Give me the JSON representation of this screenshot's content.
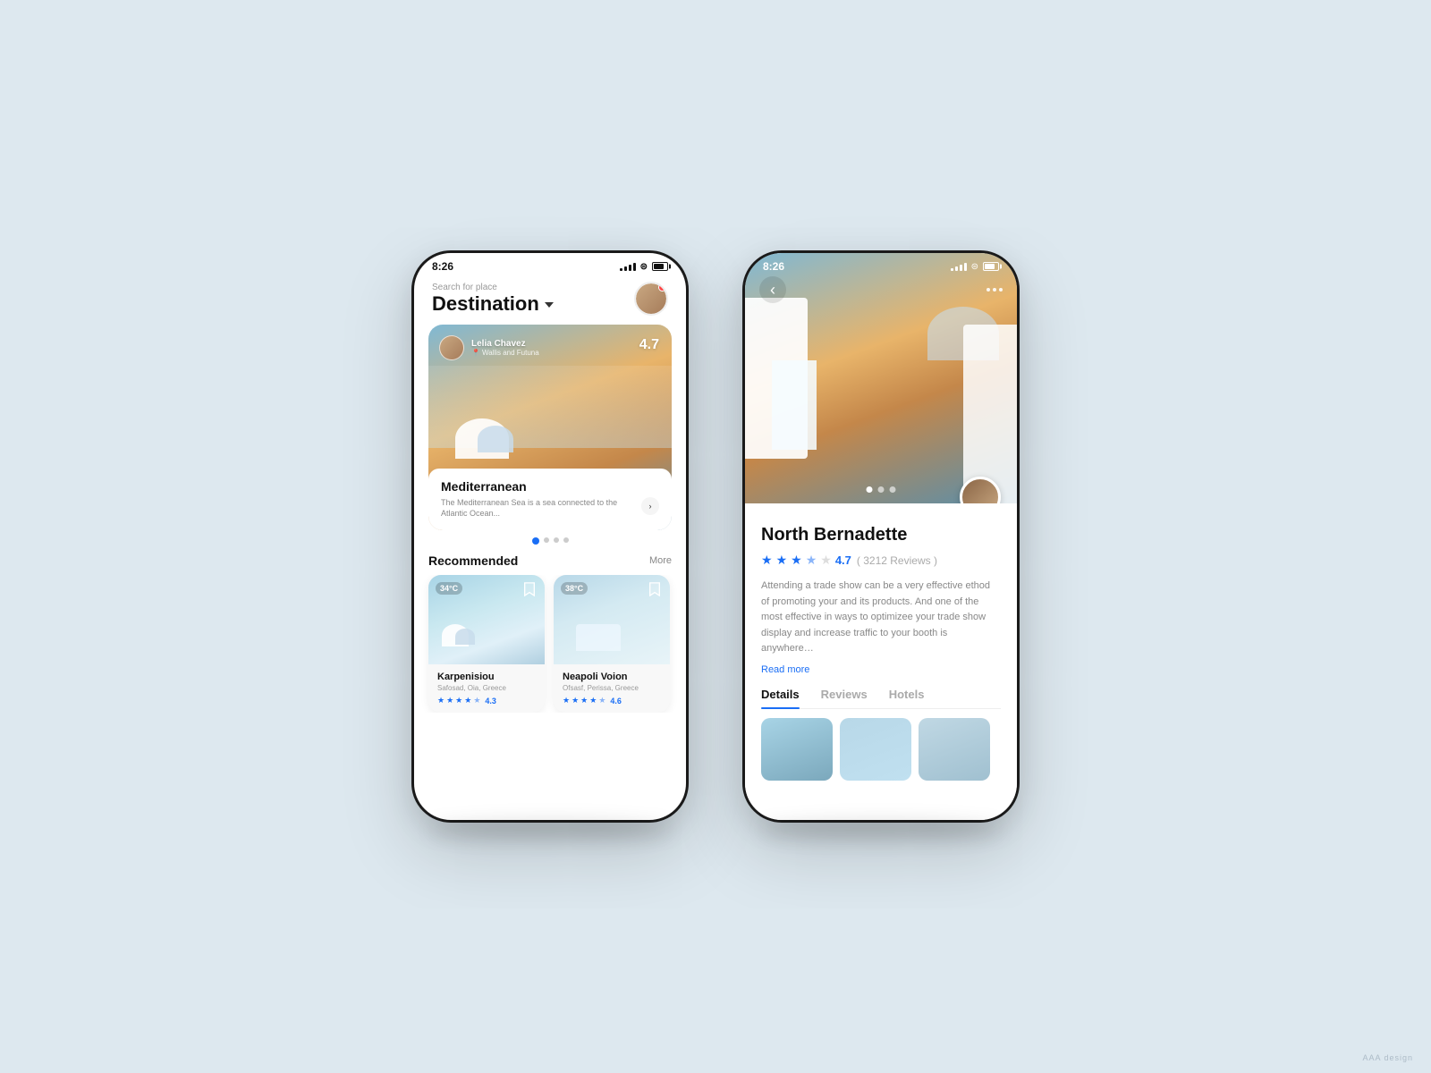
{
  "background": "#dde8ef",
  "phone1": {
    "status": {
      "time": "8:26",
      "signal": "4 bars",
      "wifi": true,
      "battery": "full"
    },
    "header": {
      "search_label": "Search for place",
      "title": "Destination",
      "dropdown_icon": "chevron-down"
    },
    "featured": {
      "user_name": "Lelia Chavez",
      "user_location": "Wallis and Futuna",
      "rating": "4.7",
      "place_name": "Mediterranean",
      "place_desc": "The Mediterranean Sea is a sea connected to the Atlantic Ocean...",
      "dots": [
        true,
        false,
        false,
        false
      ]
    },
    "recommended": {
      "section_title": "Recommended",
      "more_label": "More",
      "cards": [
        {
          "temp": "34°C",
          "name": "Karpenisiou",
          "location": "Safosad, Oia, Greece",
          "stars": 4.3,
          "rating": "4.3"
        },
        {
          "temp": "38°C",
          "name": "Neapoli Voion",
          "location": "Ofsasf, Perissa, Greece",
          "stars": 4.6,
          "rating": "4.6"
        }
      ]
    }
  },
  "phone2": {
    "status": {
      "time": "8:26",
      "signal": "4 bars",
      "wifi": true,
      "battery": "full"
    },
    "detail": {
      "place_name": "North Bernadette",
      "rating": "4.7",
      "reviews": "3212 Reviews",
      "stars": 4.7,
      "description": "Attending a trade show can be a very effective ethod of promoting your and its products. And one of the most effective in ways to optimizee your trade show display and increase traffic to your booth is anywhere…",
      "read_more": "Read more",
      "tabs": [
        "Details",
        "Reviews",
        "Hotels"
      ],
      "active_tab": "Details",
      "dots": [
        true,
        false,
        false
      ],
      "thumbnails": 3
    }
  },
  "watermark": "AAA design"
}
